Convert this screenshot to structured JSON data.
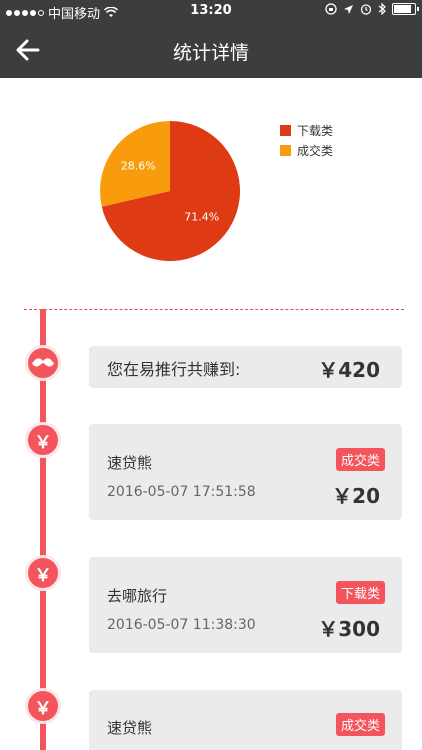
{
  "status_bar": {
    "carrier": "中国移动",
    "time": "13:20"
  },
  "nav": {
    "title": "统计详情"
  },
  "chart_data": {
    "type": "pie",
    "slices": [
      {
        "label": "下载类",
        "value": 71.4,
        "display": "71.4%",
        "color": "#de3a14"
      },
      {
        "label": "成交类",
        "value": 28.6,
        "display": "28.6%",
        "color": "#f89c0e"
      }
    ],
    "legend_position": "top-right"
  },
  "summary": {
    "label": "您在易推行共赚到:",
    "amount": "￥420"
  },
  "records": [
    {
      "name": "速贷熊",
      "tag": "成交类",
      "date": "2016-05-07 17:51:58",
      "amount": "￥20"
    },
    {
      "name": "去哪旅行",
      "tag": "下载类",
      "date": "2016-05-07 11:38:30",
      "amount": "￥300"
    },
    {
      "name": "速贷熊",
      "tag": "成交类",
      "date": "",
      "amount": ""
    }
  ],
  "icons": {
    "yen": "￥"
  },
  "colors": {
    "accent": "#f2555c",
    "header": "#3c3d3f"
  }
}
